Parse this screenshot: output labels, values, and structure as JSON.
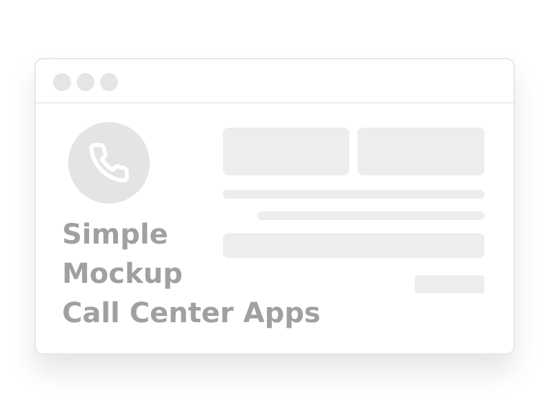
{
  "window": {
    "title_lines": [
      "Simple",
      "Mockup",
      "Call Center Apps"
    ],
    "controls": [
      "window-control",
      "window-control",
      "window-control"
    ]
  },
  "avatar": {
    "icon": "phone-icon"
  },
  "colors": {
    "background": "#ffffff",
    "window_border": "#e7e7e7",
    "placeholder": "#ededed",
    "avatar": "#e4e4e4",
    "text": "#a0a0a0"
  }
}
